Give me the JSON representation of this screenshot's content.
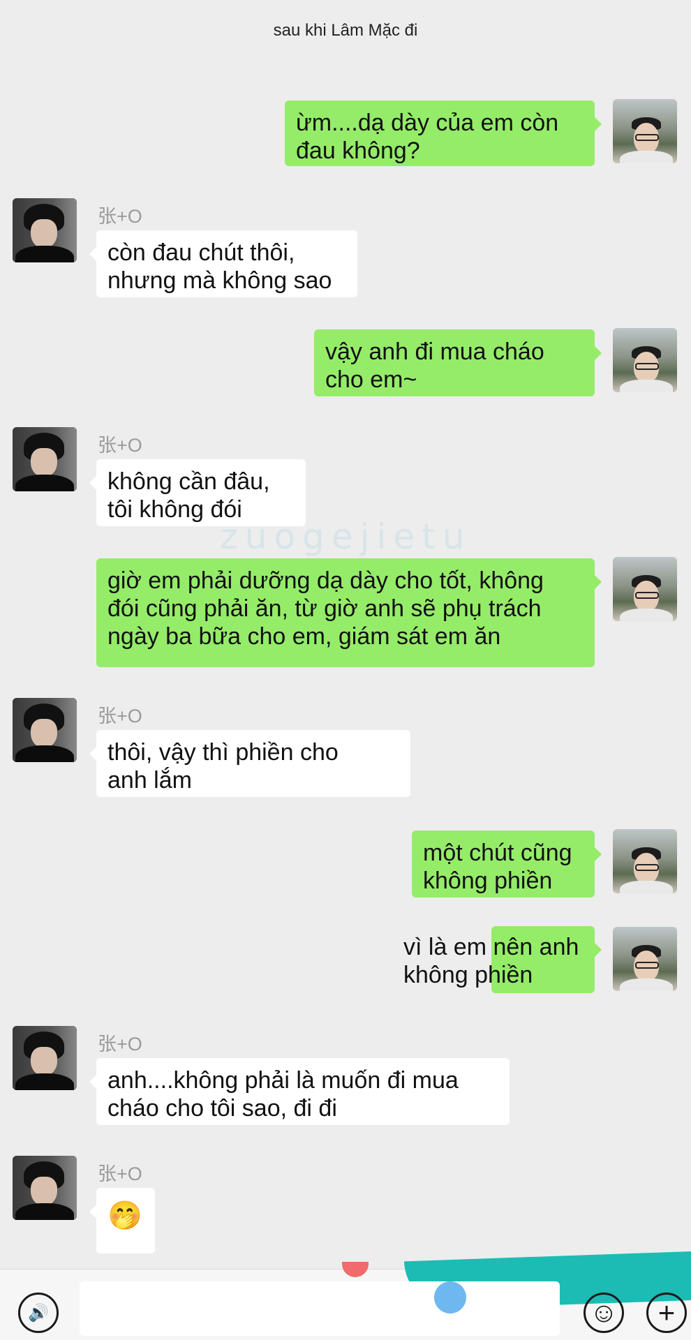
{
  "header": {
    "title": "sau khi Lâm Mặc đi"
  },
  "watermark": "zuogejietu",
  "messages": [
    {
      "side": "right",
      "text": "ừm....dạ dày của em còn\nđau không?"
    },
    {
      "side": "left",
      "name": "张+O",
      "text": "còn đau chút thôi,\nnhưng mà không sao"
    },
    {
      "side": "right",
      "text": "vậy anh đi mua cháo\ncho em~"
    },
    {
      "side": "left",
      "name": "张+O",
      "text": "không cần đâu,\ntôi không đói"
    },
    {
      "side": "right",
      "text": "giờ em phải dưỡng dạ dày cho tốt, không\nđói cũng phải ăn, từ giờ anh sẽ phụ trách\nngày ba bữa cho em, giám sát em ăn"
    },
    {
      "side": "left",
      "name": "张+O",
      "text": "thôi, vậy thì phiền cho\nanh lắm"
    },
    {
      "side": "right",
      "text": "một chút cũng\nkhông phiền"
    },
    {
      "side": "right",
      "text": "vì là em nên anh\nkhông phiền"
    },
    {
      "side": "left",
      "name": "张+O",
      "text": "anh....không phải là muốn đi mua\ncháo cho tôi sao, đi đi"
    },
    {
      "side": "left",
      "name": "张+O",
      "text": "🤭"
    }
  ],
  "input_bar": {
    "voice_icon": "voice-icon",
    "emoji_icon": "emoji-icon",
    "plus_icon": "plus-icon",
    "voice_glyph": "🔊",
    "emoji_glyph": "☺",
    "plus_glyph": "+"
  }
}
